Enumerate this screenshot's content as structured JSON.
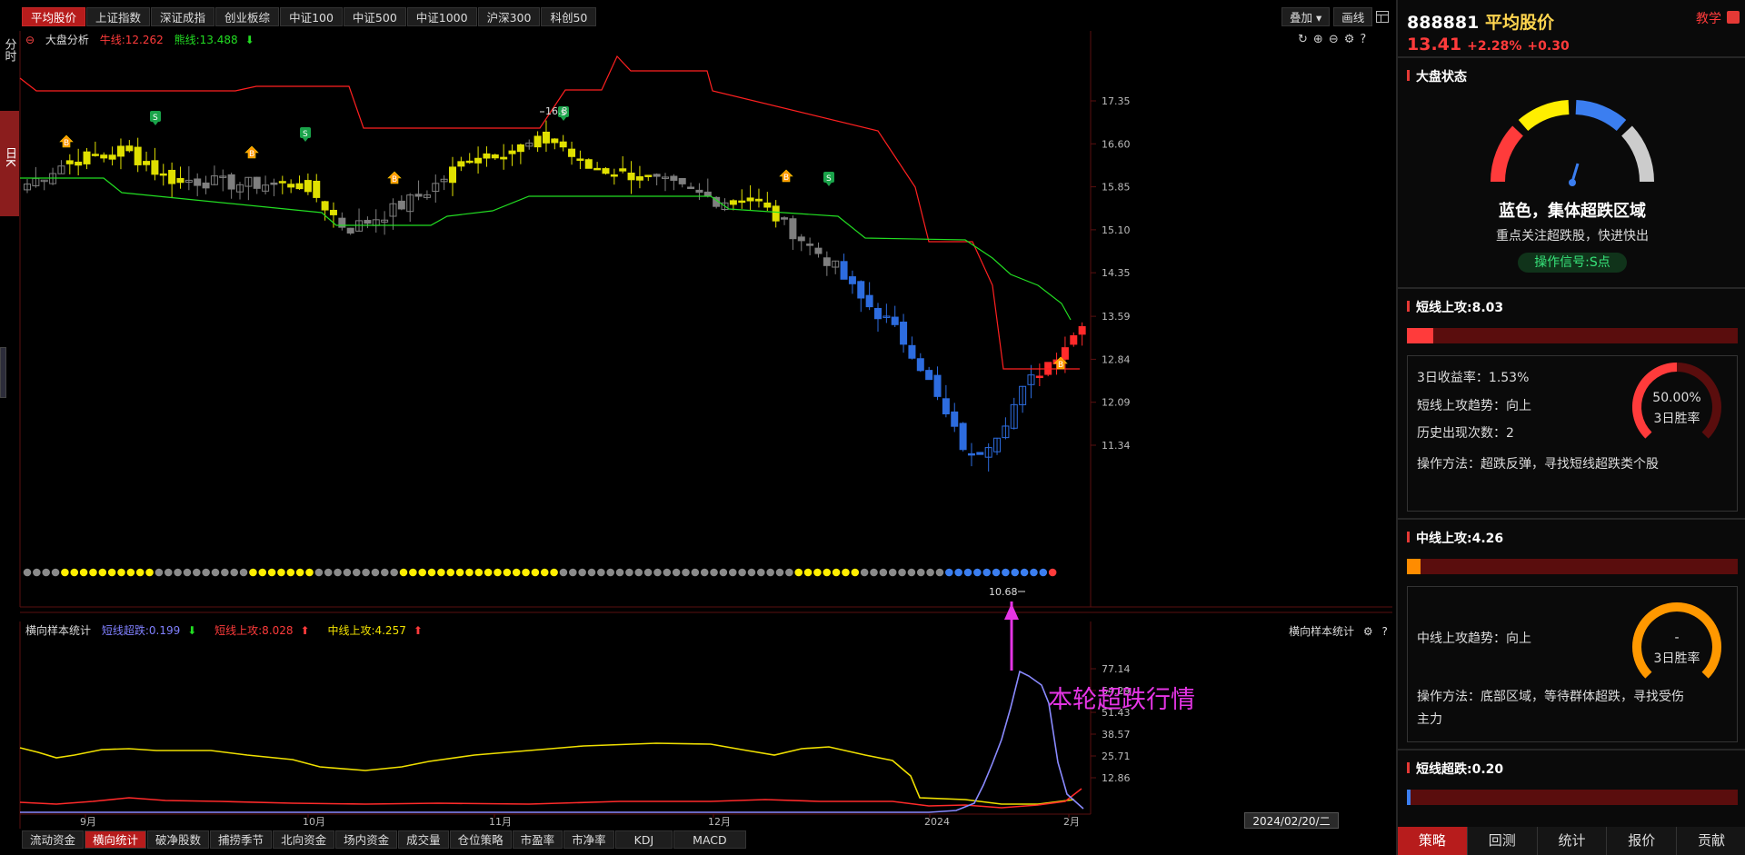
{
  "top_tabs": [
    "平均股价",
    "上证指数",
    "深证成指",
    "创业板综",
    "中证100",
    "中证500",
    "中证1000",
    "沪深300",
    "科创50"
  ],
  "top_tools": {
    "overlay": "叠加",
    "draw": "画线"
  },
  "left_tabs": {
    "fenshi": "分时",
    "rik": "日K"
  },
  "main_chart": {
    "title": "大盘分析",
    "bull_line": "牛线:12.262",
    "bear_line": "熊线:13.488",
    "bear_arrow": "⬇",
    "high_label": "16.8",
    "low_label": "10.68",
    "y_ticks": [
      "17.35",
      "16.60",
      "15.85",
      "15.10",
      "14.35",
      "13.59",
      "12.84",
      "12.09",
      "11.34"
    ],
    "x_ticks": [
      "9月",
      "10月",
      "11月",
      "12月",
      "2024",
      "2月"
    ],
    "colors": {
      "bull": "#e0e000",
      "neutral": "#7f7f7f",
      "blue": "#2d6cdf",
      "red": "#ff2a2a",
      "upper_band": "#ff2020",
      "lower_band": "#22dd22"
    }
  },
  "sub_chart": {
    "title": "横向样本统计",
    "right_title": "横向样本统计",
    "short_drop": "短线超跌:0.199",
    "short_drop_arrow": "⬇",
    "short_attack": "短线上攻:8.028",
    "short_attack_arrow": "⬆",
    "mid_attack": "中线上攻:4.257",
    "mid_attack_arrow": "⬆",
    "y_ticks": [
      "77.14",
      "64.29",
      "51.43",
      "38.57",
      "25.71",
      "12.86"
    ],
    "x_ticks": [
      "9月",
      "10月",
      "11月",
      "12月",
      "2024",
      "2月"
    ],
    "annotation": "本轮超跌行情",
    "current_date": "2024/02/20/二"
  },
  "bottom_tabs": [
    "流动资金",
    "横向统计",
    "破净股数",
    "捕捞季节",
    "北向资金",
    "场内资金",
    "成交量",
    "仓位策略",
    "市盈率",
    "市净率",
    "KDJ",
    "MACD"
  ],
  "right_panel": {
    "code": "888881",
    "name": "平均股价",
    "price": "13.41",
    "change_pct": "+2.28%",
    "change": "+0.30",
    "teach": "教学",
    "market_state": {
      "title": "大盘状态",
      "state_text": "蓝色，集体超跌区域",
      "advice": "重点关注超跌股，快进快出",
      "signal": "操作信号:S点"
    },
    "short_attack": {
      "title": "短线上攻:8.03",
      "level": 0.08,
      "ret_3d": "3日收益率：1.53%",
      "trend": "短线上攻趋势：向上",
      "count": "历史出现次数：2",
      "method": "操作方法：超跌反弹，寻找短线超跌类个股",
      "win_pct": "50.00%",
      "win_label": "3日胜率",
      "win_value": 0.5
    },
    "mid_attack": {
      "title": "中线上攻:4.26",
      "level": 0.04,
      "trend": "中线上攻趋势：向上",
      "method_l1": "操作方法：底部区域，等待群体超跌，寻找受伤",
      "method_l2": "主力",
      "win_pct": "-",
      "win_label": "3日胜率",
      "win_value": 1.0
    },
    "short_drop": {
      "title": "短线超跌:0.20",
      "level": 0.01
    },
    "tabs": [
      "策略",
      "回测",
      "统计",
      "报价",
      "贡献"
    ]
  }
}
